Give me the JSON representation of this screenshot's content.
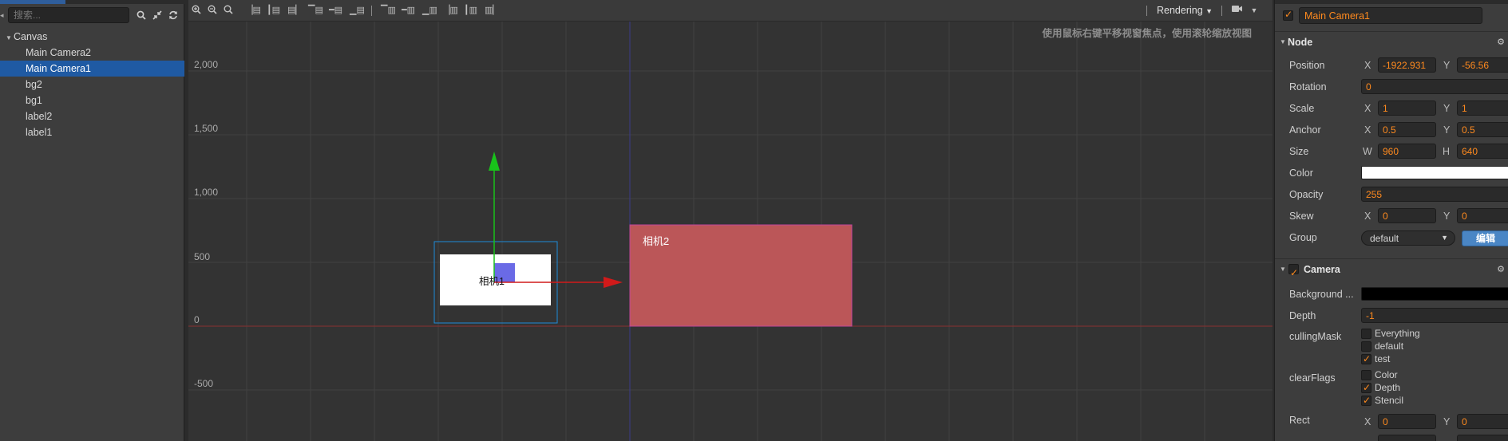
{
  "hierarchy": {
    "search_placeholder": "搜索...",
    "tree": {
      "root_label": "Canvas",
      "children": [
        "Main Camera2",
        "Main Camera1",
        "bg2",
        "bg1",
        "label2",
        "label1"
      ],
      "selected": "Main Camera1"
    },
    "toolbar_icons": [
      "search-icon",
      "collapse-icon",
      "refresh-icon"
    ]
  },
  "scene": {
    "toolbar_icons": [
      "zoom-in-icon",
      "zoom-out-icon",
      "zoom-reset-icon",
      "align-left-icon",
      "align-hcenter-icon",
      "align-right-icon",
      "align-top-icon",
      "align-vcenter-icon",
      "align-bottom-icon",
      "distribute-top-icon",
      "distribute-vcenter-icon",
      "distribute-bottom-icon",
      "distribute-left-icon",
      "distribute-hcenter-icon",
      "distribute-right-icon"
    ],
    "rendering_label": "Rendering",
    "camera_icon": "camera-icon",
    "hint": "使用鼠标右键平移视窗焦点，使用滚轮缩放视图",
    "y_axis_labels": [
      "2,000",
      "1,500",
      "1,000",
      "500",
      "0",
      "-500"
    ],
    "camera2_label": "相机2",
    "camera1_label": "相机1",
    "colors": {
      "camera2_fill": "#bb5658",
      "camera2_border": "#c0459a",
      "selection_border": "#1e8bd8",
      "gizmo_up": "#19c21b",
      "gizmo_right": "#d11a1a",
      "origin_line": "#8a3030"
    }
  },
  "inspector": {
    "node_name": "Main Camera1",
    "node_enabled": true,
    "node_section": {
      "title": "Node",
      "position": {
        "label": "Position",
        "x_label": "X",
        "x": "-1922.931",
        "y_label": "Y",
        "y": "-56.56"
      },
      "rotation": {
        "label": "Rotation",
        "value": "0"
      },
      "scale": {
        "label": "Scale",
        "x_label": "X",
        "x": "1",
        "y_label": "Y",
        "y": "1"
      },
      "anchor": {
        "label": "Anchor",
        "x_label": "X",
        "x": "0.5",
        "y_label": "Y",
        "y": "0.5"
      },
      "size": {
        "label": "Size",
        "w_label": "W",
        "w": "960",
        "h_label": "H",
        "h": "640"
      },
      "color": {
        "label": "Color",
        "value": "#ffffff"
      },
      "opacity": {
        "label": "Opacity",
        "value": "255"
      },
      "skew": {
        "label": "Skew",
        "x_label": "X",
        "x": "0",
        "y_label": "Y",
        "y": "0"
      },
      "group": {
        "label": "Group",
        "value": "default",
        "edit_button": "编辑"
      }
    },
    "camera_section": {
      "title": "Camera",
      "enabled": true,
      "background": {
        "label": "Background ...",
        "value": "#000000"
      },
      "depth": {
        "label": "Depth",
        "value": "-1"
      },
      "culling_mask": {
        "label": "cullingMask",
        "options": [
          {
            "label": "Everything",
            "checked": false
          },
          {
            "label": "default",
            "checked": false
          },
          {
            "label": "test",
            "checked": true
          }
        ]
      },
      "clear_flags": {
        "label": "clearFlags",
        "options": [
          {
            "label": "Color",
            "checked": false
          },
          {
            "label": "Depth",
            "checked": true
          },
          {
            "label": "Stencil",
            "checked": true
          }
        ]
      },
      "rect": {
        "label": "Rect",
        "x_label": "X",
        "x": "0",
        "y_label": "Y",
        "y": "0"
      }
    }
  }
}
